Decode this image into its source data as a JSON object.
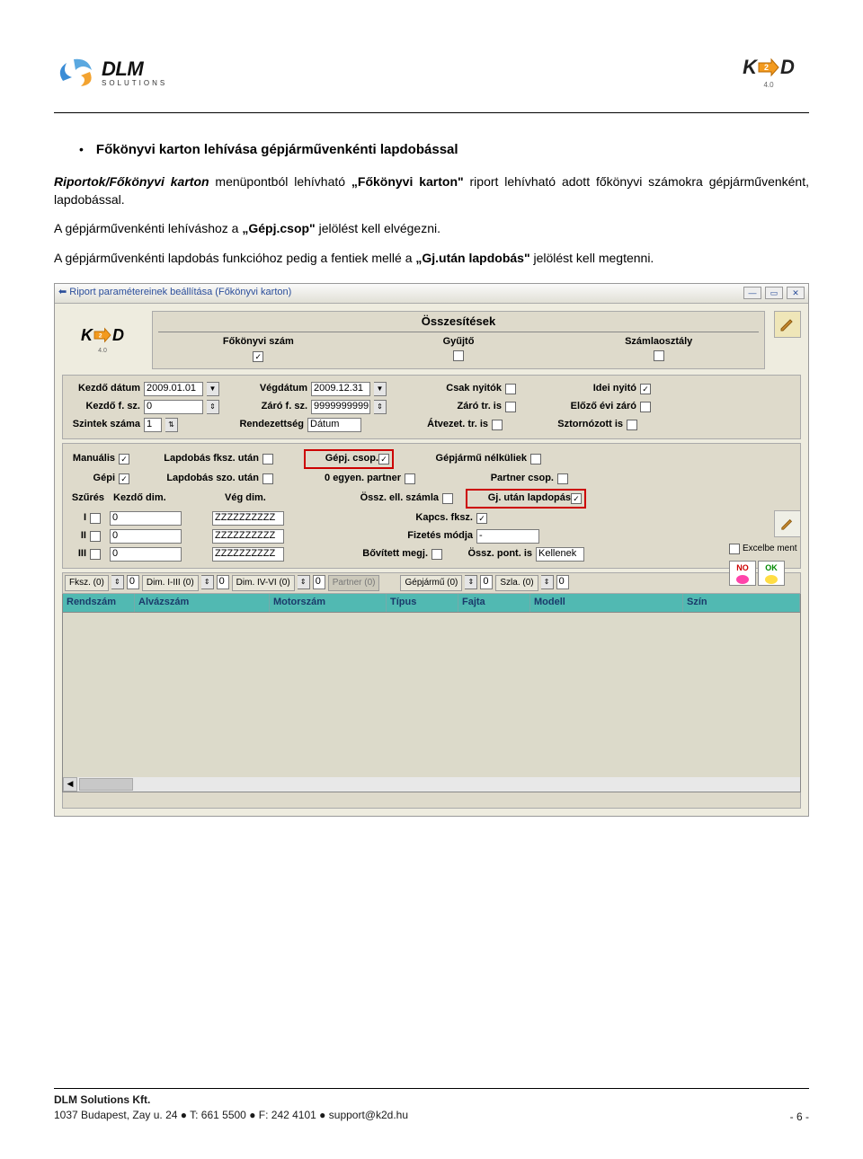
{
  "header": {
    "company_name": "DLM",
    "company_sub": "SOLUTIONS",
    "product": "K2D",
    "product_ver": "4.0"
  },
  "content": {
    "heading": "Főkönyvi karton lehívása gépjárművenkénti lapdobással",
    "p1_parts": {
      "a": "Riportok/Főkönyvi karton",
      "b": " menüpontból lehívható ",
      "c": "„Főkönyvi karton\"",
      "d": " riport lehívható adott főkönyvi számokra gépjárművenként, lapdobással."
    },
    "p2_parts": {
      "a": "A gépjárművenkénti lehíváshoz a ",
      "b": "„Gépj.csop\"",
      "c": " jelölést kell elvégezni."
    },
    "p3_parts": {
      "a": "A gépjárművenkénti lapdobás funkcióhoz pedig a fentiek mellé a ",
      "b": "„Gj.után lapdobás\"",
      "c": " jelölést kell megtenni."
    }
  },
  "win": {
    "title": "Riport paramétereinek beállítása  (Főkönyvi karton)",
    "summaries": "Összesítések",
    "col_fokonyv": "Főkönyvi szám",
    "col_gyujto": "Gyűjtő",
    "col_szamlaosztaly": "Számlaosztály",
    "labels": {
      "kezdo_datum": "Kezdő dátum",
      "vegdatum": "Végdátum",
      "csak_nyitok": "Csak nyitók",
      "idei_nyito": "Idei nyitó",
      "kezdo_fsz": "Kezdő f. sz.",
      "zaro_fsz": "Záró f. sz.",
      "zaro_tr": "Záró tr. is",
      "elozo_evi": "Előző évi záró",
      "szintek": "Szintek száma",
      "rendezettseg": "Rendezettség",
      "atvezet": "Átvezet. tr. is",
      "sztornozott": "Sztornózott is",
      "manualis": "Manuális",
      "lapdobas_fksz": "Lapdobás fksz. után",
      "gepj_csop": "Gépj. csop.",
      "gepjarmu_nelkuliek": "Gépjármű nélküliek",
      "gepi": "Gépi",
      "lapdobas_szo": "Lapdobás szo. után",
      "egyen_partner": "0 egyen. partner",
      "partner_csop": "Partner csop.",
      "szures": "Szűrés",
      "kezdo_dim": "Kezdő dim.",
      "veg_dim": "Vég dim.",
      "ossz_ell": "Össz. ell. számla",
      "gj_utan": "Gj. után lapdopás",
      "kapcs": "Kapcs. fksz.",
      "fizetes": "Fizetés módja",
      "bovitett": "Bővített megj.",
      "ossz_pont": "Össz. pont. is",
      "r1": "I",
      "r2": "II",
      "r3": "III"
    },
    "values": {
      "kezdo_datum": "2009.01.01",
      "vegdatum": "2009.12.31",
      "kezdo_fsz": "0",
      "zaro_fsz": "9999999999",
      "szintek": "1",
      "rendezettseg": "Dátum",
      "dim_lo": "0",
      "dim_hi": "ZZZZZZZZZZ",
      "fizetes": "-",
      "kellenek": "Kellenek"
    },
    "excel_label": "Excelbe ment",
    "no_label": "NO",
    "ok_label": "OK",
    "tabs": {
      "fksz": "Fksz. (0)",
      "dim1": "Dim. I-III (0)",
      "dim4": "Dim. IV-VI (0)",
      "partner": "Partner (0)",
      "gepjarmu": "Gépjármű (0)",
      "szla": "Szla. (0)",
      "zero": "0"
    },
    "cols": {
      "rendszam": "Rendszám",
      "alvazszam": "Alvázszám",
      "motorszam": "Motorszám",
      "tipus": "Típus",
      "fajta": "Fajta",
      "modell": "Modell",
      "szin": "Szín"
    }
  },
  "footer": {
    "company": "DLM Solutions Kft.",
    "addr": "1037 Budapest, Zay u. 24",
    "tel": "T: 661 5500",
    "fax": "F: 242 4101",
    "email": "support@k2d.hu",
    "page": "- 6 -"
  }
}
